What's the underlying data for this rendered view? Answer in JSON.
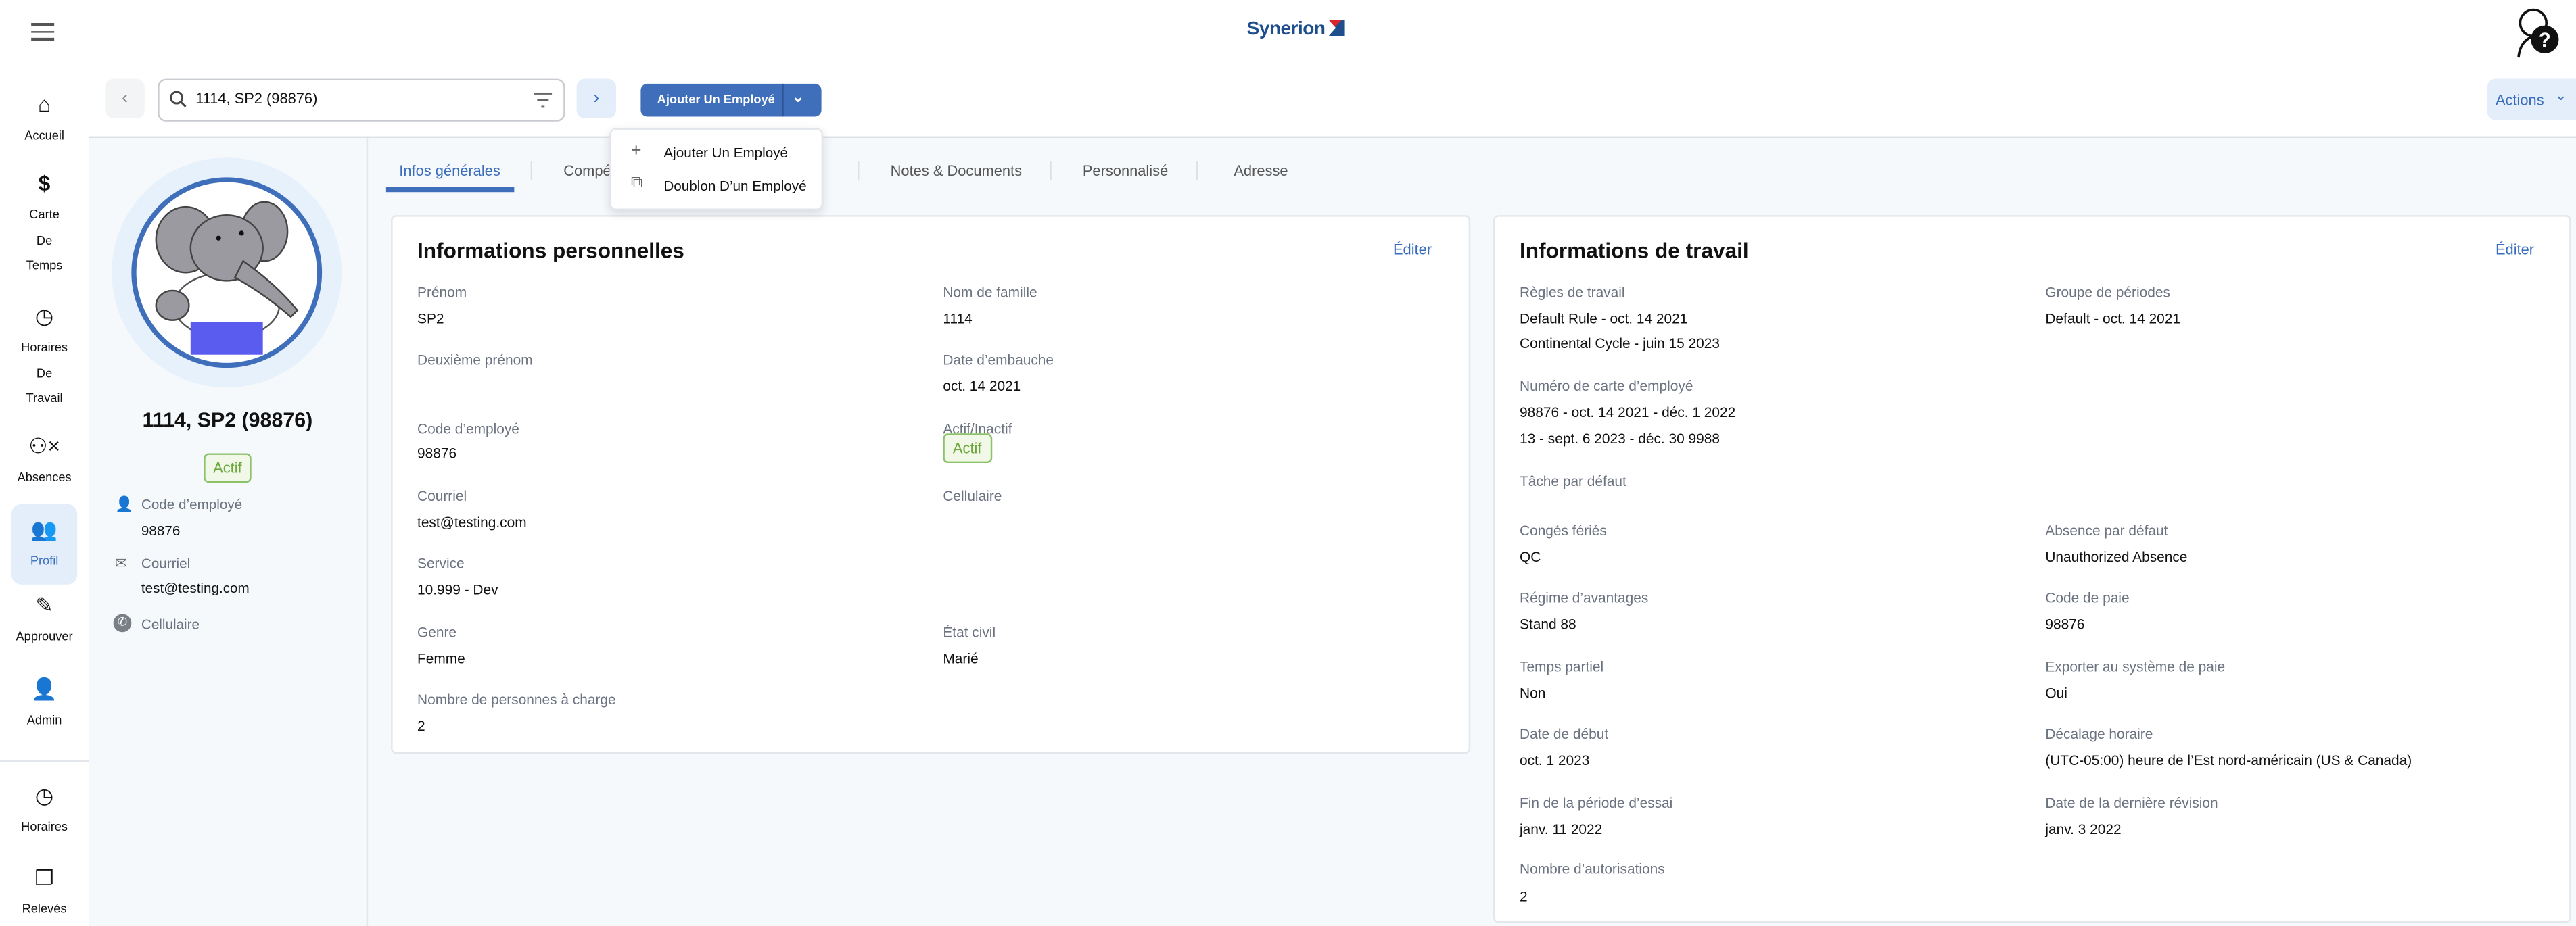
{
  "header": {
    "brand": "Synerion",
    "menu_icon": "hamburger-icon",
    "help_icon": "help-avatar-icon"
  },
  "sidebar": {
    "items": [
      {
        "id": "accueil",
        "icon": "home-icon",
        "lines": [
          "Accueil"
        ]
      },
      {
        "id": "carte-de-temps",
        "icon": "dollar-icon",
        "lines": [
          "Carte",
          "De",
          "Temps"
        ]
      },
      {
        "id": "horaires-de-travail",
        "icon": "clock-icon",
        "lines": [
          "Horaires",
          "De",
          "Travail"
        ]
      },
      {
        "id": "absences",
        "icon": "user-x-icon",
        "lines": [
          "Absences"
        ]
      },
      {
        "id": "profil",
        "icon": "people-icon",
        "lines": [
          "Profil"
        ],
        "active": true
      },
      {
        "id": "approuver",
        "icon": "approve-icon",
        "lines": [
          "Approuver"
        ]
      },
      {
        "id": "admin",
        "icon": "person-icon",
        "lines": [
          "Admin"
        ]
      },
      {
        "id": "horaires",
        "icon": "clock-icon",
        "lines": [
          "Horaires"
        ]
      },
      {
        "id": "releves",
        "icon": "documents-icon",
        "lines": [
          "Relevés"
        ]
      }
    ]
  },
  "toolbar": {
    "search_value": "1114, SP2 (98876)",
    "add_label": "Ajouter Un Employé",
    "actions_label": "Actions"
  },
  "dropdown": {
    "items": [
      "Ajouter Un Employé",
      "Doublon D’un Employé"
    ]
  },
  "profile": {
    "name": "1114, SP2 (98876)",
    "status": "Actif",
    "code_label": "Code d’employé",
    "code_value": "98876",
    "email_label": "Courriel",
    "email_value": "test@testing.com",
    "phone_label": "Cellulaire"
  },
  "tabs": [
    "Infos générales",
    "Compétences",
    "Notes & Documents",
    "Personnalisé",
    "Adresse"
  ],
  "personal": {
    "title": "Informations personnelles",
    "edit": "Éditer",
    "prenom_l": "Prénom",
    "prenom_v": "SP2",
    "nom_l": "Nom de famille",
    "nom_v": "1114",
    "deux_l": "Deuxième prénom",
    "embauche_l": "Date d’embauche",
    "embauche_v": "oct. 14 2021",
    "code_l": "Code d’employé",
    "code_v": "98876",
    "actif_l": "Actif/Inactif",
    "actif_v": "Actif",
    "courriel_l": "Courriel",
    "courriel_v": "test@testing.com",
    "cell_l": "Cellulaire",
    "service_l": "Service",
    "service_v": "10.999 - Dev",
    "genre_l": "Genre",
    "genre_v": "Femme",
    "etat_l": "État civil",
    "etat_v": "Marié",
    "charge_l": "Nombre de personnes à charge",
    "charge_v": "2"
  },
  "work": {
    "title": "Informations de travail",
    "edit": "Éditer",
    "regles_l": "Règles de travail",
    "regles_v1": "Default Rule - oct. 14 2021",
    "regles_v2": "Continental Cycle - juin 15 2023",
    "groupe_l": "Groupe de périodes",
    "groupe_v": "Default - oct. 14 2021",
    "carte_l": "Numéro de carte d’employé",
    "carte_v1": "98876 - oct. 14 2021 - déc. 1 2022",
    "carte_v2": "13 - sept. 6 2023 - déc. 30 9988",
    "tache_l": "Tâche par défaut",
    "conges_l": "Congés fériés",
    "conges_v": "QC",
    "absence_l": "Absence par défaut",
    "absence_v": "Unauthorized Absence",
    "regime_l": "Régime d’avantages",
    "regime_v": "Stand 88",
    "paie_l": "Code de paie",
    "paie_v": "98876",
    "partiel_l": "Temps partiel",
    "partiel_v": "Non",
    "export_l": "Exporter au système de paie",
    "export_v": "Oui",
    "debut_l": "Date de début",
    "debut_v": "oct. 1 2023",
    "decalage_l": "Décalage horaire",
    "decalage_v": "(UTC-05:00) heure de l’Est nord-américain (US & Canada)",
    "essai_l": "Fin de la période d’essai",
    "essai_v": "janv. 11 2022",
    "revision_l": "Date de la dernière révision",
    "revision_v": "janv. 3 2022",
    "autor_l": "Nombre d’autorisations",
    "autor_v": "2"
  },
  "colors": {
    "accent": "#3f6fba",
    "active_bg": "#e3eefa",
    "success": "#6aa63a",
    "page_bg": "#f5f9fc"
  }
}
